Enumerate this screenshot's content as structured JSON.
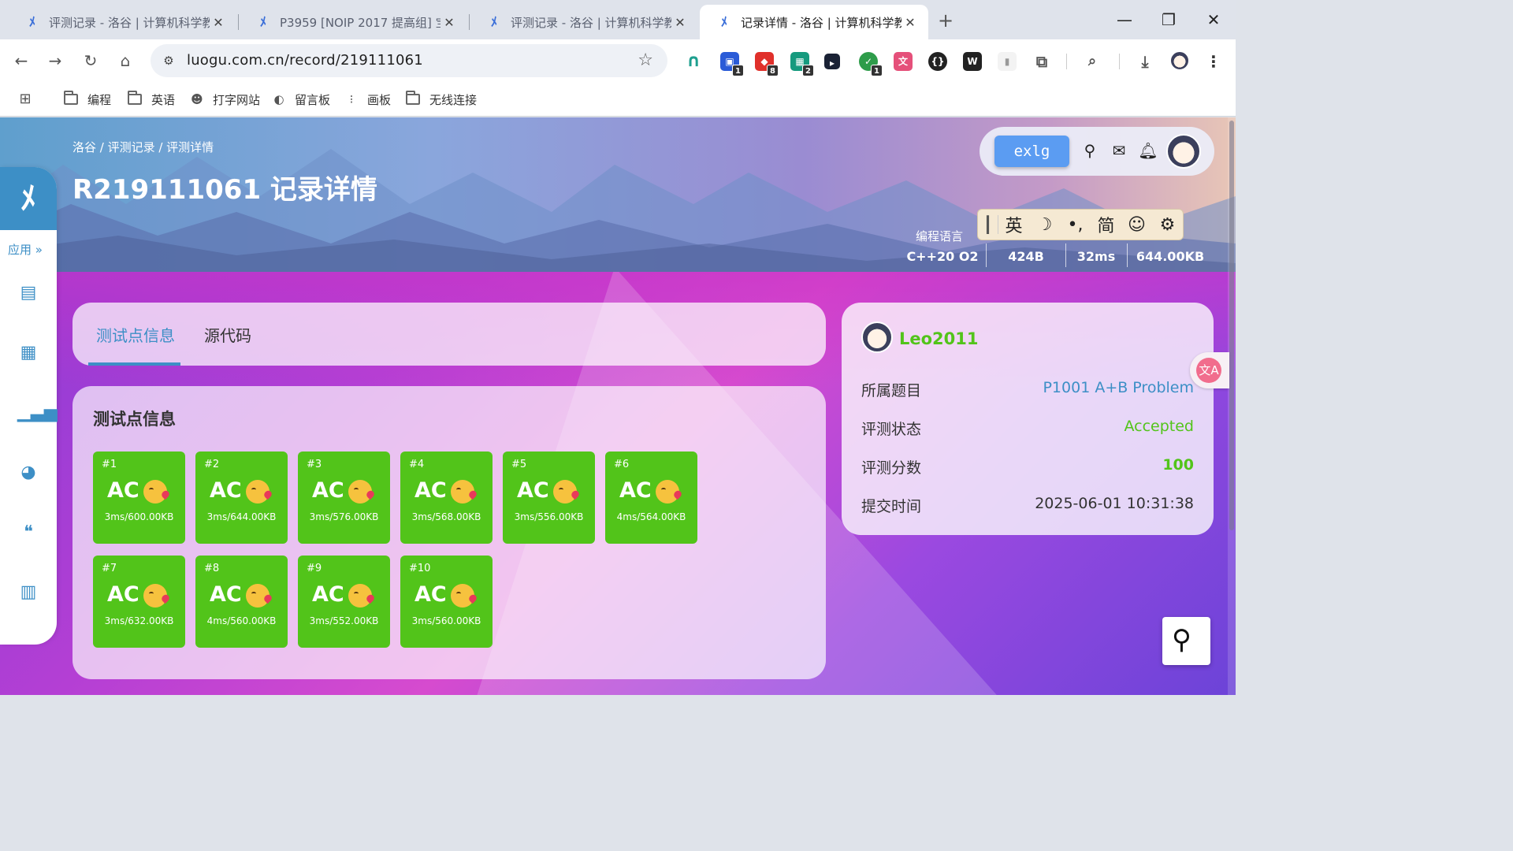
{
  "browser": {
    "tabs": [
      {
        "title": "评测记录 - 洛谷 | 计算机科学教",
        "active": false
      },
      {
        "title": "P3959 [NOIP 2017 提高组] 宝",
        "active": false
      },
      {
        "title": "评测记录 - 洛谷 | 计算机科学教",
        "active": false
      },
      {
        "title": "记录详情 - 洛谷 | 计算机科学教",
        "active": true
      }
    ],
    "url": "luogu.com.cn/record/219111061",
    "extensions": [
      {
        "name": "arch-extension-icon",
        "color": "#1e9f8f",
        "badge": ""
      },
      {
        "name": "blue-extension-icon",
        "color": "#2a5bd7",
        "badge": "1"
      },
      {
        "name": "red-extension-icon",
        "color": "#e0302b",
        "badge": "8"
      },
      {
        "name": "teal-extension-icon",
        "color": "#169a7e",
        "badge": "2"
      },
      {
        "name": "dark-extension-icon",
        "color": "#1a2235",
        "badge": ""
      },
      {
        "name": "shield-extension-icon",
        "color": "#2e9c4a",
        "badge": "1"
      },
      {
        "name": "translate-extension-icon",
        "color": "#e5507a",
        "badge": ""
      },
      {
        "name": "code-extension-icon",
        "color": "#222222",
        "badge": ""
      },
      {
        "name": "wiki-extension-icon",
        "color": "#222222",
        "badge": ""
      },
      {
        "name": "chart-extension-icon",
        "color": "#bbbbbb",
        "badge": ""
      }
    ],
    "bookmarks": [
      {
        "label": "编程",
        "icon": "folder-icon"
      },
      {
        "label": "英语",
        "icon": "folder-icon"
      },
      {
        "label": "打字网站",
        "icon": "site-icon"
      },
      {
        "label": "留言板",
        "icon": "site-icon"
      },
      {
        "label": "画板",
        "icon": "site-icon"
      },
      {
        "label": "无线连接",
        "icon": "folder-icon"
      }
    ]
  },
  "header": {
    "breadcrumb": "洛谷 / 评测记录 / 评测详情",
    "title": "R219111061 记录详情",
    "exlg_label": "exlg"
  },
  "ime": {
    "items": [
      "英",
      "☽",
      "•,",
      "简",
      "☺",
      "⚙"
    ]
  },
  "stats": {
    "label": "编程语言",
    "values": [
      "C++20 O2",
      "424B",
      "32ms",
      "644.00KB"
    ]
  },
  "sidebar": {
    "app_label": "应用 »"
  },
  "tabs": {
    "active": "测试点信息",
    "inactive": "源代码"
  },
  "main": {
    "section_title": "测试点信息",
    "testcases": [
      {
        "id": "#1",
        "status": "AC",
        "meta": "3ms/600.00KB"
      },
      {
        "id": "#2",
        "status": "AC",
        "meta": "3ms/644.00KB"
      },
      {
        "id": "#3",
        "status": "AC",
        "meta": "3ms/576.00KB"
      },
      {
        "id": "#4",
        "status": "AC",
        "meta": "3ms/568.00KB"
      },
      {
        "id": "#5",
        "status": "AC",
        "meta": "3ms/556.00KB"
      },
      {
        "id": "#6",
        "status": "AC",
        "meta": "4ms/564.00KB"
      },
      {
        "id": "#7",
        "status": "AC",
        "meta": "3ms/632.00KB"
      },
      {
        "id": "#8",
        "status": "AC",
        "meta": "4ms/560.00KB"
      },
      {
        "id": "#9",
        "status": "AC",
        "meta": "3ms/552.00KB"
      },
      {
        "id": "#10",
        "status": "AC",
        "meta": "3ms/560.00KB"
      }
    ]
  },
  "info": {
    "username": "Leo2011",
    "rows": [
      {
        "key": "所属题目",
        "value": "P1001 A+B Problem",
        "color": "#3d8fc6"
      },
      {
        "key": "评测状态",
        "value": "Accepted",
        "color": "#52c41a"
      },
      {
        "key": "评测分数",
        "value": "100",
        "color": "#52c41a"
      },
      {
        "key": "提交时间",
        "value": "2025-06-01 10:31:38",
        "color": "#333333"
      }
    ]
  },
  "colors": {
    "accent": "#3d8fc6",
    "ac_green": "#52c41a"
  }
}
